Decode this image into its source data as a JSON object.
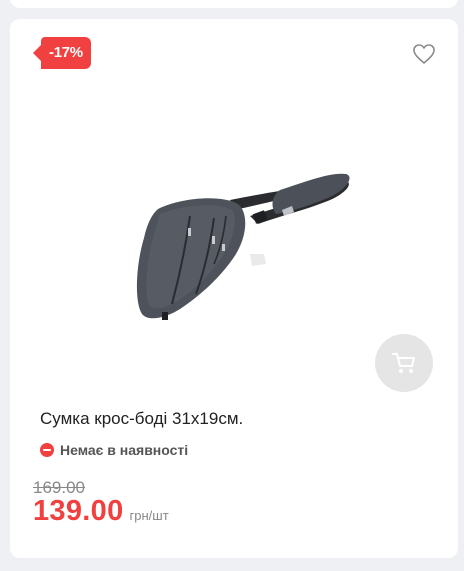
{
  "product": {
    "discount_badge": "-17%",
    "title": "Сумка крос-боді 31х19см.",
    "stock_status": "Немає в наявності",
    "old_price": "169.00",
    "price": "139.00",
    "unit": "грн/шт"
  },
  "icons": {
    "favorite": "heart-outline-icon",
    "cart": "cart-icon",
    "stock": "minus-circle-icon"
  },
  "colors": {
    "accent": "#f0403f",
    "muted": "#888888"
  }
}
